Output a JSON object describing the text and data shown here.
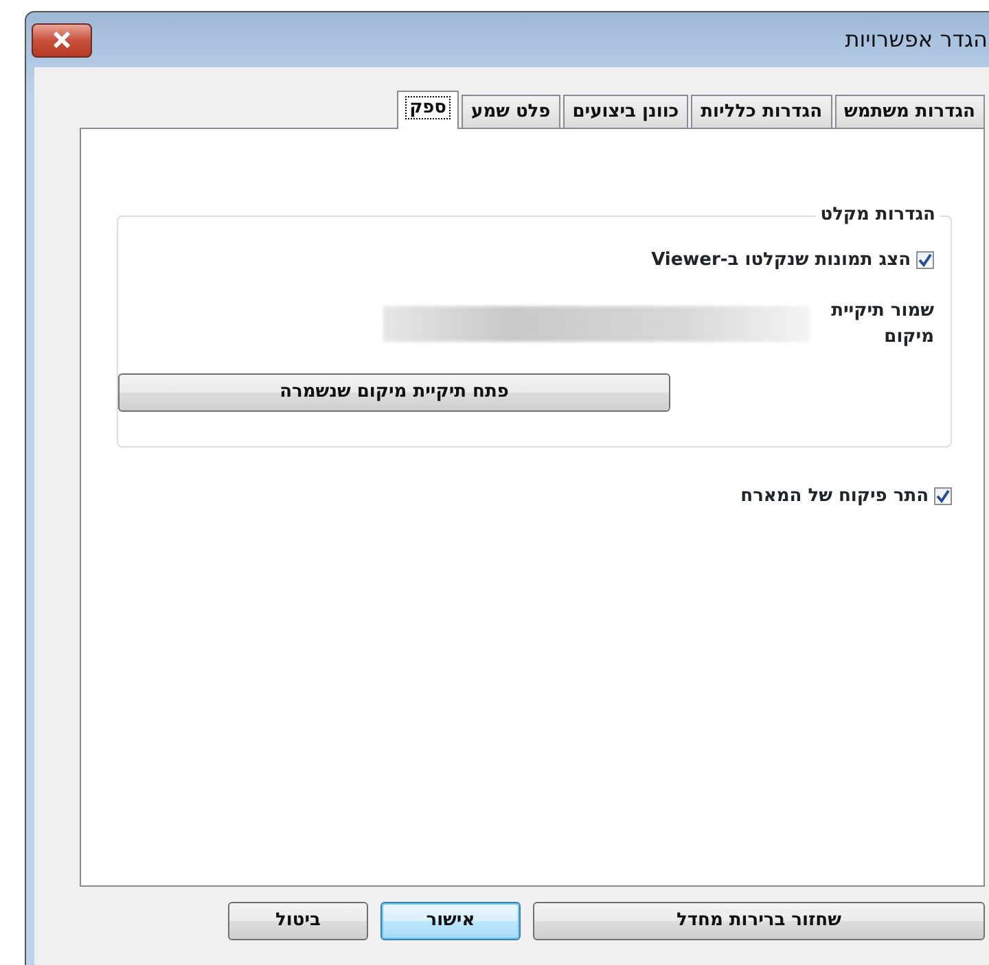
{
  "window": {
    "title": "הגדר אפשרויות"
  },
  "tabs": [
    {
      "label": "הגדרות משתמש",
      "selected": false
    },
    {
      "label": "הגדרות כלליות",
      "selected": false
    },
    {
      "label": "כוונן ביצועים",
      "selected": false
    },
    {
      "label": "פלט שמע",
      "selected": false
    },
    {
      "label": "ספק",
      "selected": true
    }
  ],
  "group": {
    "title": "הגדרות מקלט",
    "show_snapshots": {
      "label": "הצג תמונות שנקלטו ב-Viewer",
      "checked": true
    },
    "save_folder": {
      "label": "שמור תיקיית מיקום"
    },
    "open_folder_button": "פתח תיקיית מיקום שנשמרה"
  },
  "allow_host_control": {
    "label": "התר פיקוח של המארח",
    "checked": true
  },
  "buttons": [
    {
      "label": "שחזור ברירות מחדל",
      "default": false
    },
    {
      "label": "אישור",
      "default": true
    },
    {
      "label": "ביטול",
      "default": false
    }
  ]
}
